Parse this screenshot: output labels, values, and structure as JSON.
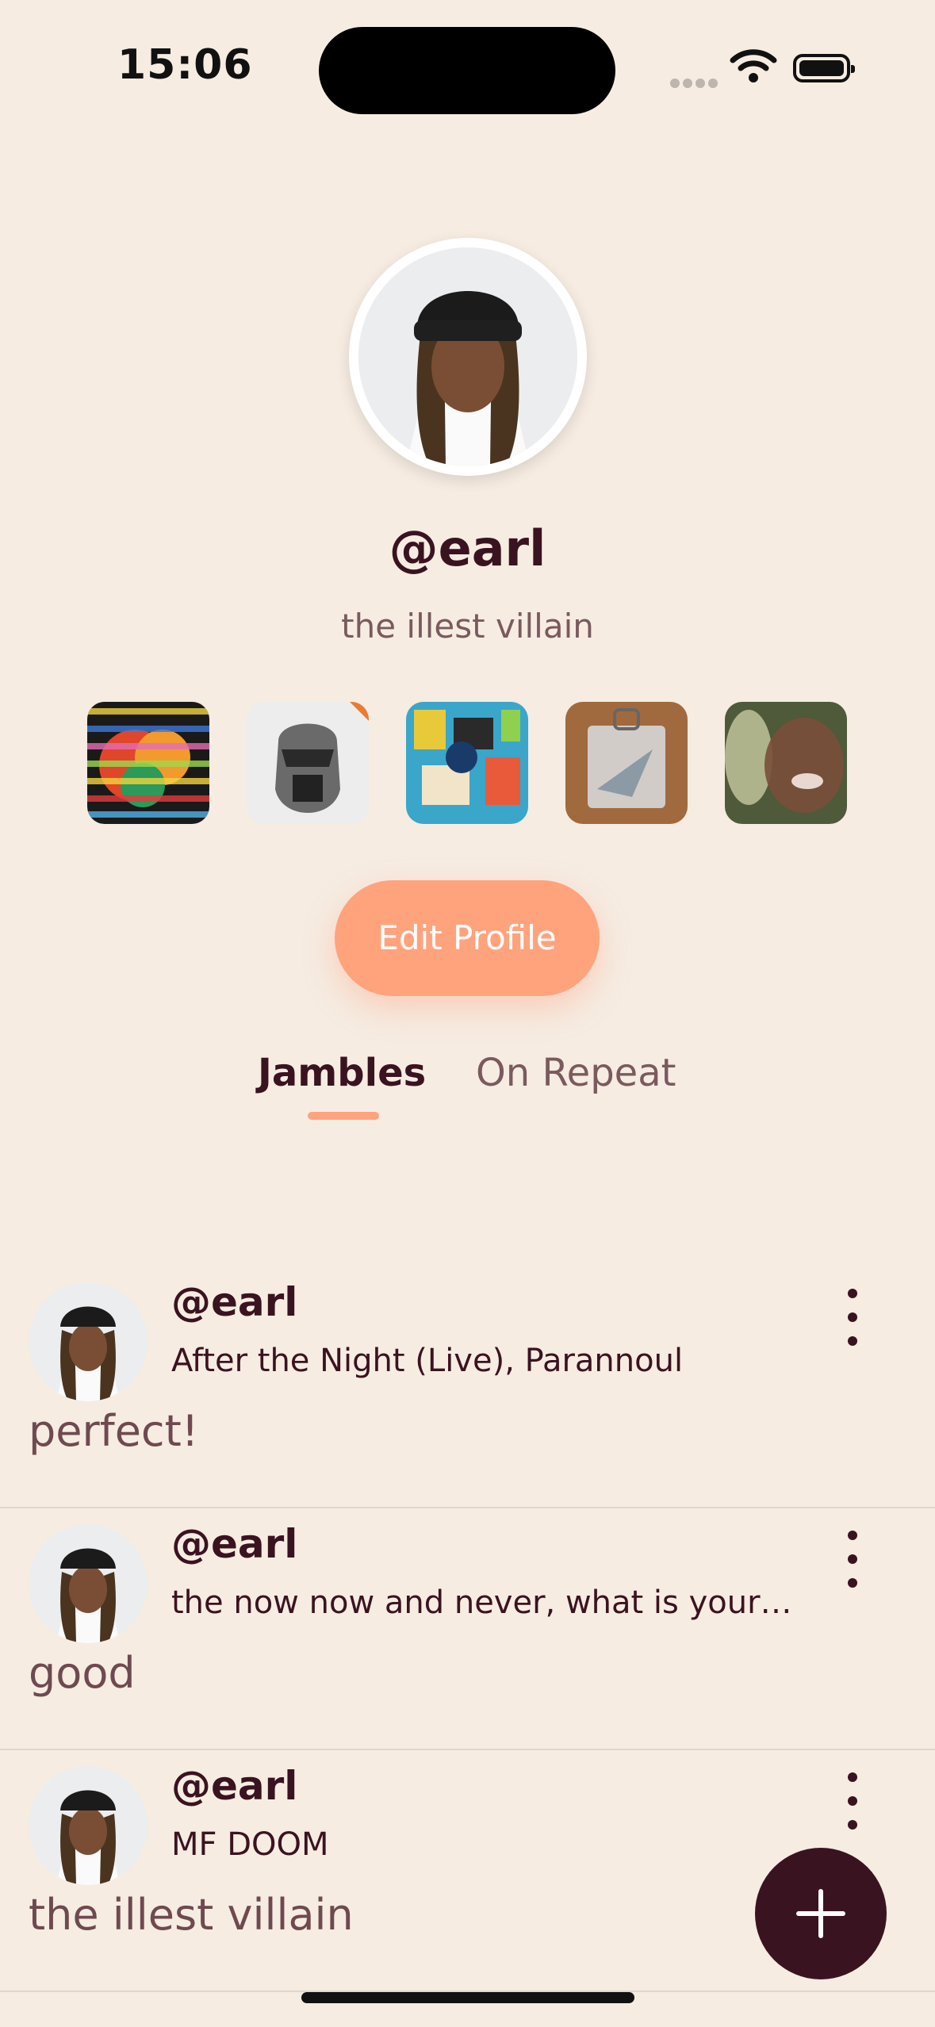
{
  "status": {
    "time": "15:06"
  },
  "profile": {
    "username": "@earl",
    "bio": "the illest villain",
    "favorite_albums": [
      "In Rainbows",
      "Madvillainy",
      "Basquiat-style art",
      "Plastic bag cover",
      "Blurred portrait"
    ],
    "edit_label": "Edit Profile"
  },
  "tabs": {
    "active": "Jambles",
    "inactive": "On Repeat"
  },
  "posts": [
    {
      "handle": "@earl",
      "track": "After the Night (Live), Parannoul",
      "comment": "perfect!"
    },
    {
      "handle": "@earl",
      "track": "the now now and never, what is your…",
      "comment": "good"
    },
    {
      "handle": "@earl",
      "track": "MF DOOM",
      "comment": "the illest villain"
    }
  ],
  "colors": {
    "background": "#F6ECE2",
    "accent": "#FFA37D",
    "primary": "#3A1320"
  },
  "icons": [
    "wifi-icon",
    "battery-icon",
    "more-vertical-icon",
    "plus-icon"
  ]
}
